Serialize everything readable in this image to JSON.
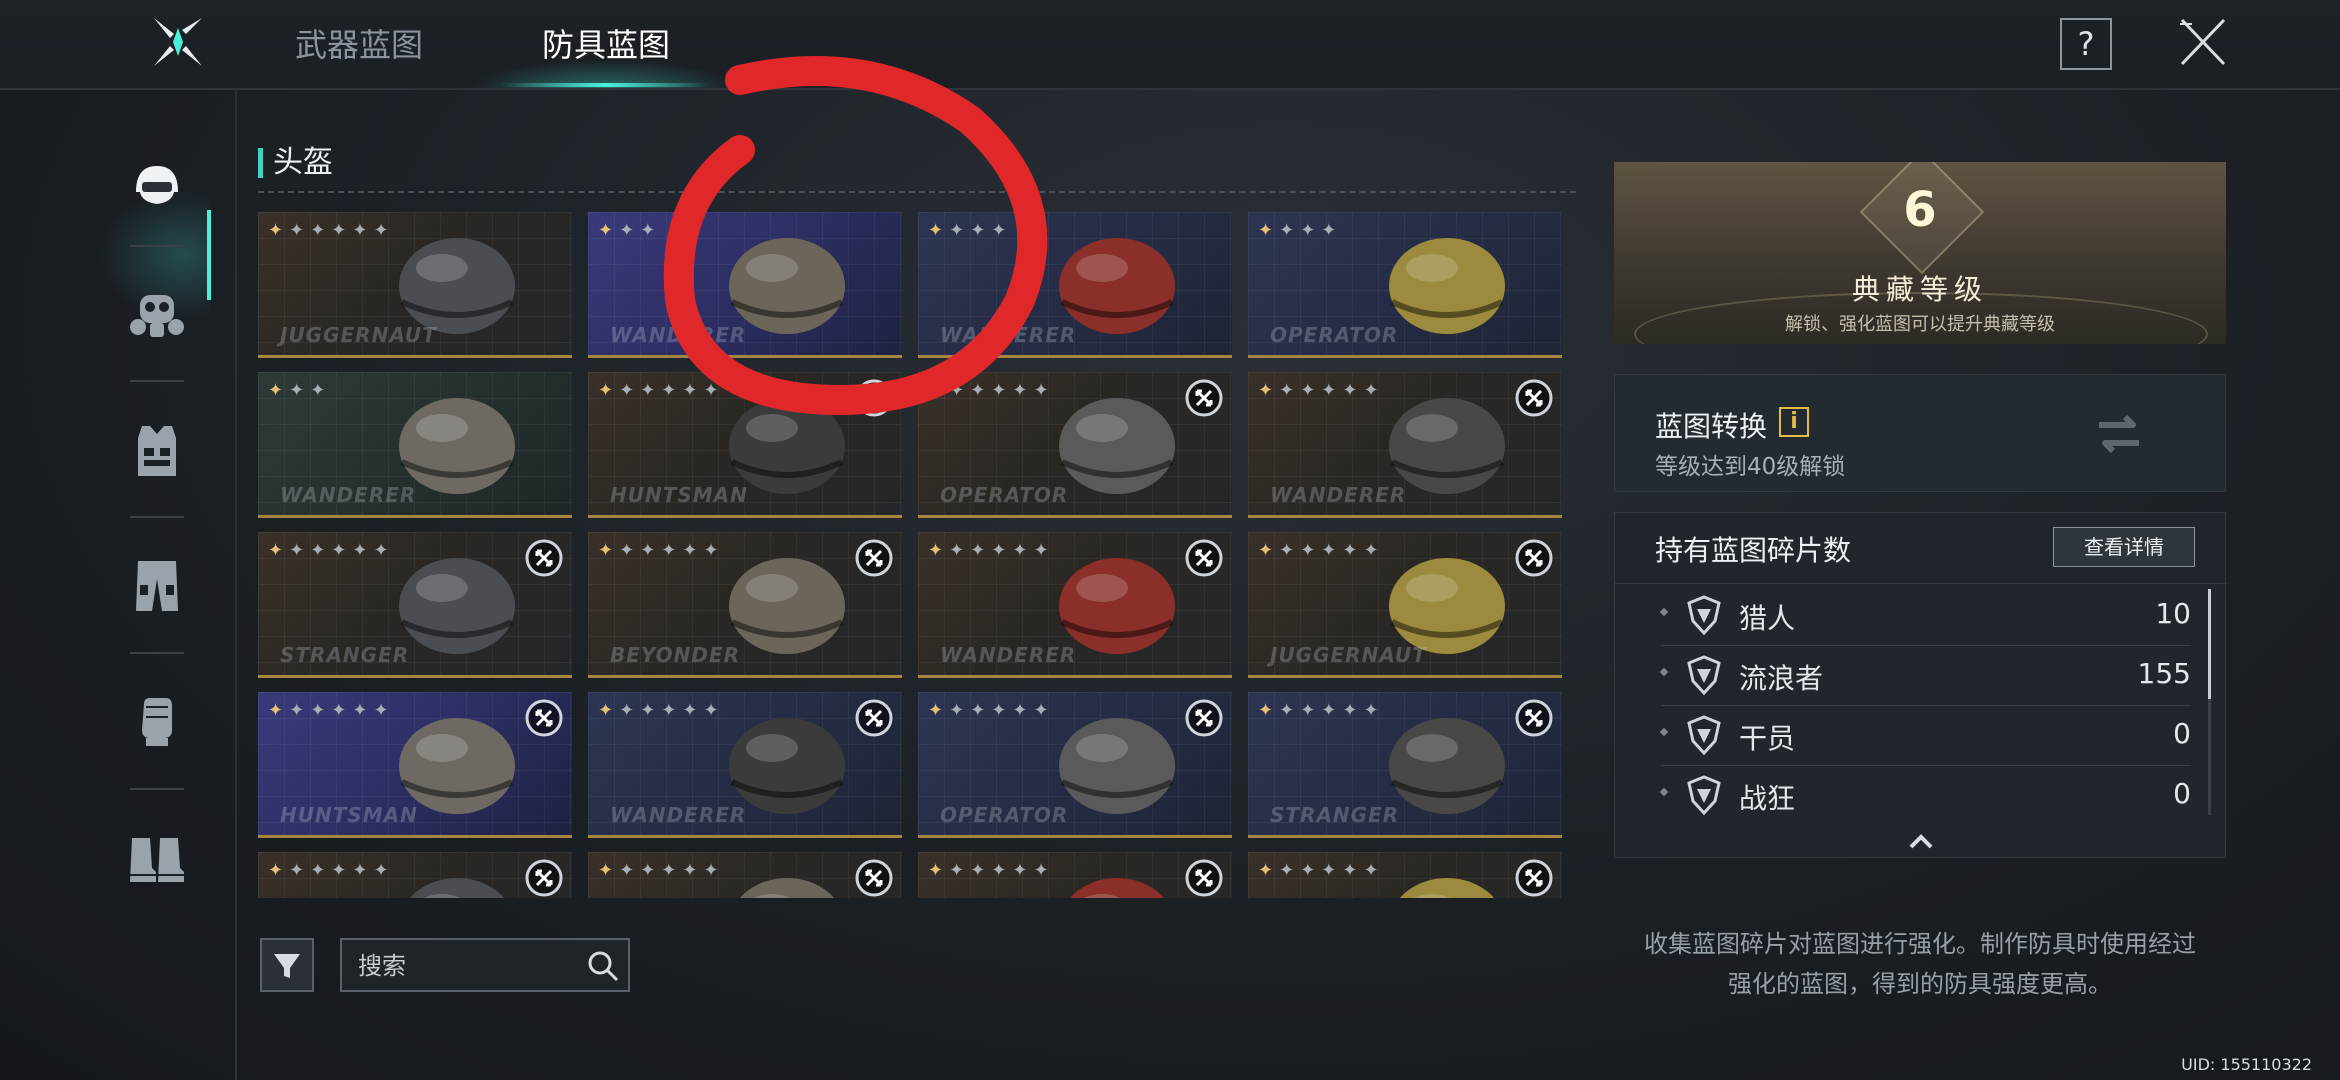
{
  "header": {
    "tabs": [
      {
        "label": "武器蓝图",
        "active": false
      },
      {
        "label": "防具蓝图",
        "active": true
      }
    ],
    "help_label": "?",
    "icons": {
      "logo": "x-star-logo-icon",
      "help": "question-icon",
      "close": "close-x-icon"
    }
  },
  "sidebar": {
    "items": [
      {
        "name": "helmet",
        "icon": "helmet-icon",
        "active": true
      },
      {
        "name": "mask",
        "icon": "gas-mask-icon",
        "active": false
      },
      {
        "name": "armor",
        "icon": "vest-icon",
        "active": false
      },
      {
        "name": "pants",
        "icon": "pants-icon",
        "active": false
      },
      {
        "name": "gloves",
        "icon": "glove-icon",
        "active": false
      },
      {
        "name": "boots",
        "icon": "boots-icon",
        "active": false
      }
    ]
  },
  "section": {
    "title": "头盔"
  },
  "cards": [
    {
      "tag": "JUGGERNAUT",
      "stars": 6,
      "gold": 1,
      "theme": "brown",
      "locked": false
    },
    {
      "tag": "WANDERER",
      "stars": 3,
      "gold": 1,
      "theme": "purple",
      "locked": false
    },
    {
      "tag": "WANDERER",
      "stars": 4,
      "gold": 1,
      "theme": "blue",
      "locked": false
    },
    {
      "tag": "OPERATOR",
      "stars": 4,
      "gold": 1,
      "theme": "blue",
      "locked": false
    },
    {
      "tag": "WANDERER",
      "stars": 3,
      "gold": 1,
      "theme": "green",
      "locked": false
    },
    {
      "tag": "HUNTSMAN",
      "stars": 6,
      "gold": 1,
      "theme": "brown",
      "locked": true
    },
    {
      "tag": "OPERATOR",
      "stars": 6,
      "gold": 1,
      "theme": "brown",
      "locked": true
    },
    {
      "tag": "WANDERER",
      "stars": 6,
      "gold": 1,
      "theme": "brown",
      "locked": true
    },
    {
      "tag": "STRANGER",
      "stars": 6,
      "gold": 1,
      "theme": "brown",
      "locked": true
    },
    {
      "tag": "BEYONDER",
      "stars": 6,
      "gold": 1,
      "theme": "brown",
      "locked": true
    },
    {
      "tag": "WANDERER",
      "stars": 6,
      "gold": 1,
      "theme": "brown",
      "locked": true
    },
    {
      "tag": "JUGGERNAUT",
      "stars": 6,
      "gold": 1,
      "theme": "brown",
      "locked": true
    },
    {
      "tag": "HUNTSMAN",
      "stars": 6,
      "gold": 1,
      "theme": "purple",
      "locked": true
    },
    {
      "tag": "WANDERER",
      "stars": 6,
      "gold": 1,
      "theme": "blue",
      "locked": true
    },
    {
      "tag": "OPERATOR",
      "stars": 6,
      "gold": 1,
      "theme": "blue",
      "locked": true
    },
    {
      "tag": "STRANGER",
      "stars": 6,
      "gold": 1,
      "theme": "blue",
      "locked": true
    },
    {
      "tag": "",
      "stars": 6,
      "gold": 1,
      "theme": "brown",
      "locked": true
    },
    {
      "tag": "",
      "stars": 6,
      "gold": 1,
      "theme": "brown",
      "locked": true
    },
    {
      "tag": "",
      "stars": 6,
      "gold": 1,
      "theme": "brown",
      "locked": true
    },
    {
      "tag": "",
      "stars": 6,
      "gold": 1,
      "theme": "brown",
      "locked": true
    }
  ],
  "search": {
    "placeholder": "搜索",
    "filter_icon": "funnel-icon",
    "search_icon": "magnifier-icon"
  },
  "collection": {
    "level": "6",
    "title": "典藏等级",
    "subtitle": "解锁、强化蓝图可以提升典藏等级"
  },
  "convert": {
    "title": "蓝图转换",
    "info": "i",
    "subtitle": "等级达到40级解锁",
    "icon": "swap-arrows-icon"
  },
  "shards": {
    "title": "持有蓝图碎片数",
    "detail_button": "查看详情",
    "rows": [
      {
        "name": "猎人",
        "count": "10"
      },
      {
        "name": "流浪者",
        "count": "155"
      },
      {
        "name": "干员",
        "count": "0"
      },
      {
        "name": "战狂",
        "count": "0"
      }
    ],
    "collapse_icon": "chevron-up-icon"
  },
  "footnote": [
    "收集蓝图碎片对蓝图进行强化。制作防具时使用经过",
    "强化的蓝图，得到的防具强度更高。"
  ],
  "uid": "UID: 155110322",
  "colors": {
    "accent": "#49f0dc",
    "gold": "#e3c074",
    "annotation": "#e0282a"
  }
}
